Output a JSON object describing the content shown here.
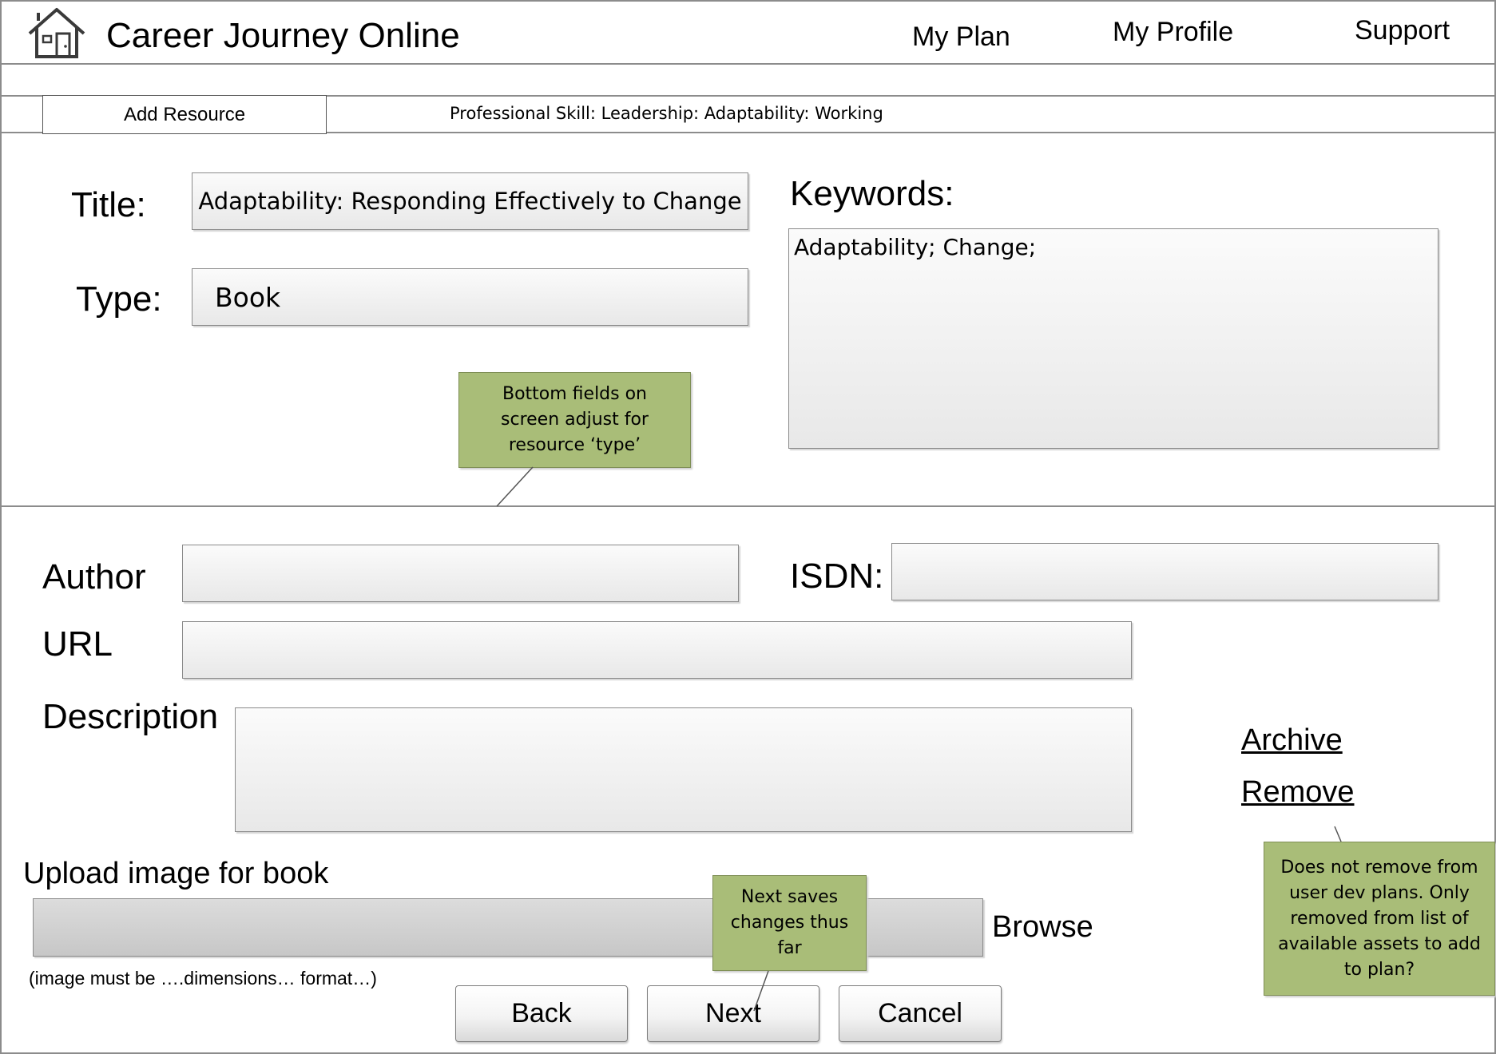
{
  "header": {
    "title": "Career Journey Online",
    "nav": [
      "My Plan",
      "My Profile",
      "Support"
    ]
  },
  "subheader": {
    "tab_label": "Add Resource",
    "breadcrumb": "Professional Skill: Leadership: Adaptability: Working"
  },
  "form": {
    "title_label": "Title:",
    "title_value": "Adaptability: Responding Effectively to Change",
    "type_label": "Type:",
    "type_value": "Book",
    "keywords_label": "Keywords:",
    "keywords_value": "Adaptability; Change;",
    "author_label": "Author",
    "author_value": "",
    "isdn_label": "ISDN:",
    "isdn_value": "",
    "url_label": "URL",
    "url_value": "",
    "description_label": "Description",
    "description_value": "",
    "upload_label": "Upload image for book",
    "browse_label": "Browse",
    "upload_hint": "(image must be ….dimensions… format…)"
  },
  "side_links": {
    "archive": "Archive",
    "remove": "Remove"
  },
  "buttons": {
    "back": "Back",
    "next": "Next",
    "cancel": "Cancel"
  },
  "notes": {
    "type_note": "Bottom fields on screen adjust for resource ‘type’",
    "next_note": "Next saves changes thus far",
    "remove_note": "Does not remove from user dev plans. Only removed from list of available assets to add to plan?"
  },
  "colors": {
    "note_fill": "#a9bd78",
    "border": "#8c8c8c"
  }
}
